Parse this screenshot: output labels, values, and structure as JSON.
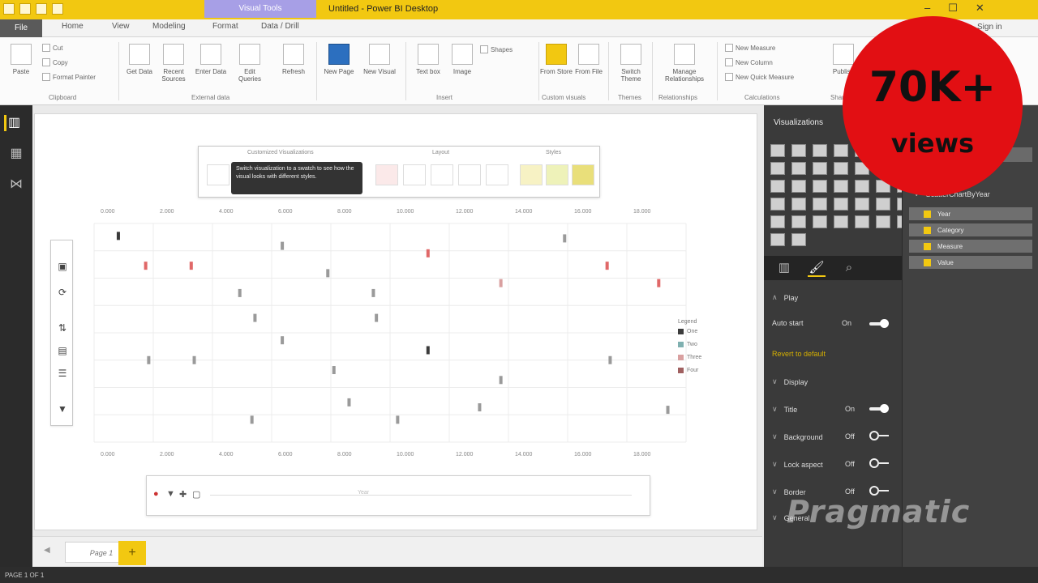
{
  "window": {
    "title": "Untitled - Power BI Desktop",
    "context_tab": "Visual Tools"
  },
  "tabs": {
    "file": "File",
    "items": [
      "Home",
      "View",
      "Modeling",
      "Format",
      "Data / Drill"
    ],
    "signin": "Sign in"
  },
  "ribbon": {
    "buttons": [
      "Paste",
      "Get Data",
      "Recent Sources",
      "Enter Data",
      "Edit Queries",
      "Refresh",
      "New Page",
      "New Visual",
      "Text box",
      "Image",
      "Shapes",
      "From Store",
      "From File",
      "Switch Theme",
      "Manage Relationships",
      "New Measure",
      "New Column",
      "New Quick Measure",
      "Publish"
    ],
    "small": [
      "Cut",
      "Copy",
      "Format Painter"
    ],
    "groups": [
      "Clipboard",
      "External data",
      "Insert",
      "Custom visuals",
      "Themes",
      "Relationships",
      "Calculations",
      "Share"
    ]
  },
  "overlay": {
    "left_label": "Customized Visualizations",
    "mid_label": "Layout",
    "right_label": "Styles",
    "tooltip": "Switch visualization to a swatch to see how the visual looks with different styles."
  },
  "chart_data": {
    "type": "scatter",
    "x_ticks": [
      "0.000",
      "2.000",
      "4.000",
      "6.000",
      "8.000",
      "10.000",
      "12.000",
      "14.000",
      "16.000",
      "18.000"
    ],
    "points": [
      {
        "x": 0.8,
        "y": 7.8,
        "s": 0
      },
      {
        "x": 6.2,
        "y": 7.4,
        "s": 1
      },
      {
        "x": 11.0,
        "y": 7.1,
        "s": 3
      },
      {
        "x": 15.5,
        "y": 7.7,
        "s": 1
      },
      {
        "x": 1.7,
        "y": 6.6,
        "s": 3
      },
      {
        "x": 3.2,
        "y": 6.6,
        "s": 3
      },
      {
        "x": 7.7,
        "y": 6.3,
        "s": 1
      },
      {
        "x": 13.4,
        "y": 5.9,
        "s": 2
      },
      {
        "x": 16.9,
        "y": 6.6,
        "s": 3
      },
      {
        "x": 18.6,
        "y": 5.9,
        "s": 3
      },
      {
        "x": 4.8,
        "y": 5.5,
        "s": 1
      },
      {
        "x": 9.2,
        "y": 5.5,
        "s": 1
      },
      {
        "x": 5.3,
        "y": 4.5,
        "s": 1
      },
      {
        "x": 9.3,
        "y": 4.5,
        "s": 1
      },
      {
        "x": 6.2,
        "y": 3.6,
        "s": 1
      },
      {
        "x": 11.0,
        "y": 3.2,
        "s": 0
      },
      {
        "x": 1.8,
        "y": 2.8,
        "s": 1
      },
      {
        "x": 3.3,
        "y": 2.8,
        "s": 1
      },
      {
        "x": 7.9,
        "y": 2.4,
        "s": 1
      },
      {
        "x": 13.4,
        "y": 2.0,
        "s": 1
      },
      {
        "x": 17.0,
        "y": 2.8,
        "s": 1
      },
      {
        "x": 8.4,
        "y": 1.1,
        "s": 1
      },
      {
        "x": 12.7,
        "y": 0.9,
        "s": 1
      },
      {
        "x": 5.2,
        "y": 0.4,
        "s": 1
      },
      {
        "x": 10.0,
        "y": 0.4,
        "s": 1
      },
      {
        "x": 18.9,
        "y": 0.8,
        "s": 1
      }
    ],
    "xlim": [
      0,
      19.5
    ],
    "ylim": [
      -0.5,
      8.3
    ],
    "series_colors": [
      "#3b3b3b",
      "#9a9a9a",
      "#d9a0a0",
      "#e06868"
    ],
    "legend": {
      "title": "Legend",
      "items": [
        "One",
        "Two",
        "Three",
        "Four"
      ]
    }
  },
  "play_axis": {
    "label": "Year"
  },
  "page_tabs": {
    "page": "Page 1",
    "add": "+"
  },
  "status": {
    "text": "PAGE 1 OF 1"
  },
  "viz_pane": {
    "title": "Visualizations",
    "sections": [
      {
        "name": "Play",
        "rows": [
          {
            "label": "Auto start",
            "state": "On",
            "toggle": "on"
          }
        ]
      },
      {
        "name": "Revert to default"
      },
      {
        "name": "Display",
        "rows": [
          {
            "label": "Title",
            "state": "On",
            "toggle": "on"
          },
          {
            "label": "Background",
            "state": "Off",
            "toggle": "off"
          },
          {
            "label": "Lock aspect",
            "state": "Off",
            "toggle": "off"
          },
          {
            "label": "Border",
            "state": "Off",
            "toggle": "off"
          },
          {
            "label": "General",
            "state": "",
            "toggle": ""
          }
        ]
      }
    ]
  },
  "fields_pane": {
    "table": "ScatterChartByYear",
    "fields": [
      "Year",
      "Category",
      "Measure",
      "Value"
    ]
  },
  "watermark": "Pragmatic",
  "badge": {
    "big": "70K+",
    "small": "views",
    "color": "#e20f13"
  }
}
